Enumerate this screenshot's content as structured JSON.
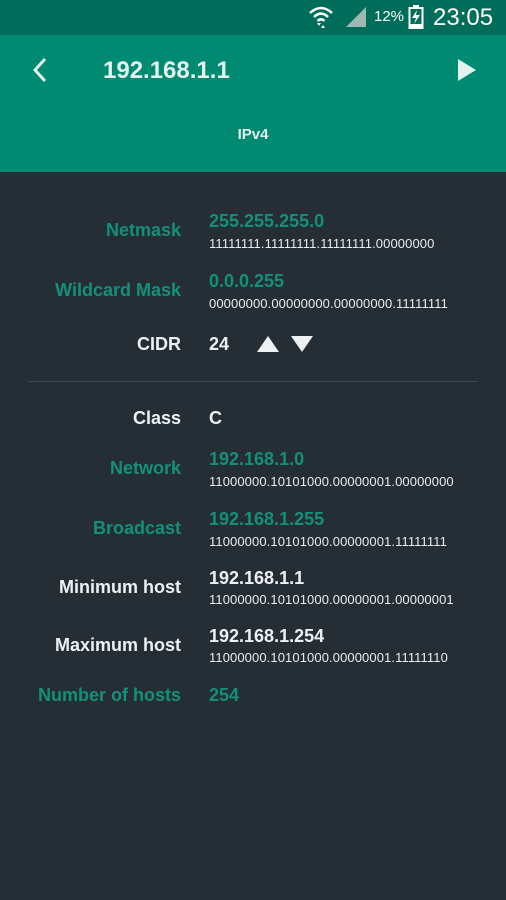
{
  "status_bar": {
    "battery_percent": "12%",
    "time": "23:05",
    "wifi_icon": "wifi-icon",
    "signal_icon": "cell-signal-icon",
    "battery_icon": "battery-charging-icon"
  },
  "app_bar": {
    "title": "192.168.1.1",
    "tab": "IPv4",
    "back_icon": "chevron-left-icon",
    "play_icon": "play-icon"
  },
  "colors": {
    "status_bar": "#006c5a",
    "app_bar": "#008a72",
    "background": "#252d35",
    "teal_accent": "#13907a"
  },
  "rows": {
    "netmask": {
      "label": "Netmask",
      "value": "255.255.255.0",
      "binary": "11111111.11111111.11111111.00000000"
    },
    "wildcard": {
      "label": "Wildcard Mask",
      "value": "0.0.0.255",
      "binary": "00000000.00000000.00000000.11111111"
    },
    "cidr": {
      "label": "CIDR",
      "value": "24"
    },
    "class": {
      "label": "Class",
      "value": "C"
    },
    "network": {
      "label": "Network",
      "value": "192.168.1.0",
      "binary": "11000000.10101000.00000001.00000000"
    },
    "broadcast": {
      "label": "Broadcast",
      "value": "192.168.1.255",
      "binary": "11000000.10101000.00000001.11111111"
    },
    "min_host": {
      "label": "Minimum host",
      "value": "192.168.1.1",
      "binary": "11000000.10101000.00000001.00000001"
    },
    "max_host": {
      "label": "Maximum host",
      "value": "192.168.1.254",
      "binary": "11000000.10101000.00000001.11111110"
    },
    "num_hosts": {
      "label": "Number of hosts",
      "value": "254"
    }
  }
}
